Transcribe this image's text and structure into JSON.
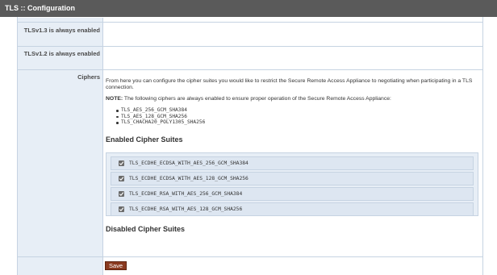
{
  "header": {
    "title": "TLS :: Configuration"
  },
  "rows": {
    "tls13_label": "TLSv1.3 is always enabled",
    "tls12_label": "TLSv1.2 is always enabled",
    "ciphers_label": "Ciphers"
  },
  "ciphers": {
    "intro": "From here you can configure the cipher suites you would like to restrict the Secure Remote Access Appliance to negotiating when participating in a TLS connection.",
    "note_label": "NOTE:",
    "note_text": " The following ciphers are always enabled to ensure proper operation of the Secure Remote Access Appliance:",
    "always_enabled": [
      "TLS_AES_256_GCM_SHA384",
      "TLS_AES_128_GCM_SHA256",
      "TLS_CHACHA20_POLY1305_SHA256"
    ],
    "enabled_heading": "Enabled Cipher Suites",
    "enabled_suites": [
      {
        "label": "TLS_ECDHE_ECDSA_WITH_AES_256_GCM_SHA384",
        "checked": true
      },
      {
        "label": "TLS_ECDHE_ECDSA_WITH_AES_128_GCM_SHA256",
        "checked": true
      },
      {
        "label": "TLS_ECDHE_RSA_WITH_AES_256_GCM_SHA384",
        "checked": true
      },
      {
        "label": "TLS_ECDHE_RSA_WITH_AES_128_GCM_SHA256",
        "checked": true
      }
    ],
    "disabled_heading": "Disabled Cipher Suites"
  },
  "actions": {
    "save_label": "Save"
  },
  "colors": {
    "title_bar": "#5a5a5a",
    "label_column": "#e7eef6",
    "border": "#c6d3e2",
    "save_button": "#8a3a1f"
  }
}
